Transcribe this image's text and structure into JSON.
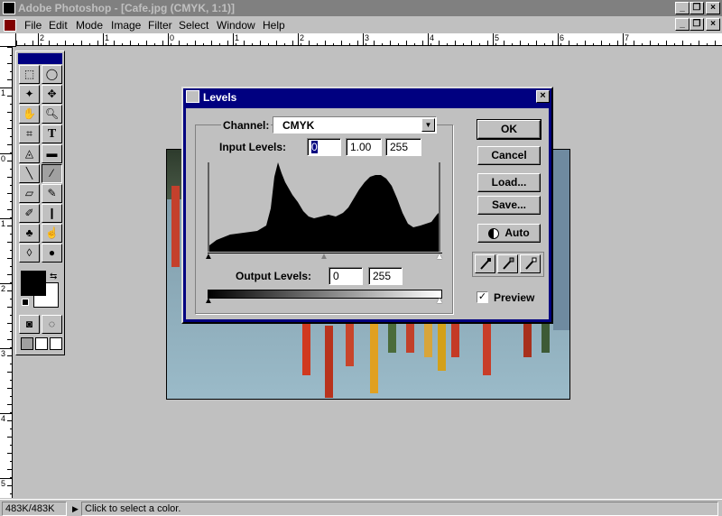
{
  "window": {
    "title": "Adobe Photoshop - [Cafe.jpg  (CMYK, 1:1)]"
  },
  "menu": [
    "File",
    "Edit",
    "Mode",
    "Image",
    "Filter",
    "Select",
    "Window",
    "Help"
  ],
  "rulers": {
    "horizontal": [
      "2",
      "1",
      "0",
      "1",
      "2",
      "3",
      "4",
      "5",
      "6",
      "7"
    ],
    "vertical": [
      "1",
      "0",
      "1",
      "2",
      "3",
      "4",
      "5"
    ]
  },
  "toolbox": {
    "tools": [
      [
        "marquee-icon",
        "lasso-icon"
      ],
      [
        "magic-wand-icon",
        "move-icon"
      ],
      [
        "hand-icon",
        "zoom-icon"
      ],
      [
        "crop-icon",
        "type-icon"
      ],
      [
        "paint-bucket-icon",
        "gradient-icon"
      ],
      [
        "line-icon",
        "eyedropper-icon"
      ],
      [
        "eraser-icon",
        "pencil-icon"
      ],
      [
        "airbrush-icon",
        "paintbrush-icon"
      ],
      [
        "rubber-stamp-icon",
        "smudge-icon"
      ],
      [
        "blur-icon",
        "dodge-icon"
      ]
    ],
    "type_glyph": "T"
  },
  "dialog": {
    "title": "Levels",
    "channel_label": "Channel:",
    "channel_value": "CMYK",
    "input_levels_label": "Input Levels:",
    "input_black": "0",
    "input_gamma": "1.00",
    "input_white": "255",
    "output_levels_label": "Output Levels:",
    "output_black": "0",
    "output_white": "255",
    "buttons": {
      "ok": "OK",
      "cancel": "Cancel",
      "load": "Load...",
      "save": "Save...",
      "auto": "Auto"
    },
    "preview_label": "Preview",
    "preview_checked": true,
    "close": "×"
  },
  "status": {
    "doc_size": "483K/483K",
    "hint": "Click to select a color."
  },
  "colors": {
    "title_active": "#000080",
    "title_inactive": "#808080",
    "face": "#c0c0c0"
  }
}
